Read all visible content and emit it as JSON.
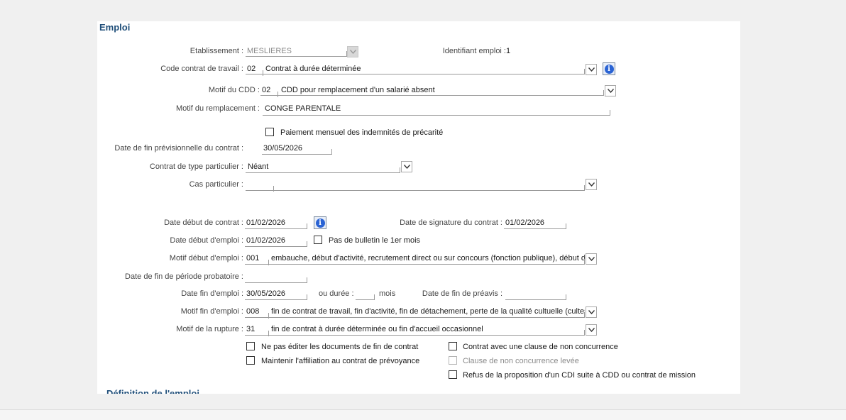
{
  "section_title": "Emploi",
  "next_section_title": "Définition de l'emploi",
  "establishment": {
    "label": "Etablissement :",
    "value": "MESLIERES"
  },
  "job_id": {
    "label": "Identifiant emploi :",
    "value": "1"
  },
  "contract_code": {
    "label": "Code contrat de travail :",
    "code": "02",
    "text": "Contrat à durée déterminée"
  },
  "cdd_reason": {
    "label": "Motif du CDD :",
    "code": "02",
    "text": "CDD pour remplacement d'un salarié absent"
  },
  "replacement_reason": {
    "label": "Motif du remplacement :",
    "value": "CONGE PARENTALE"
  },
  "monthly_payment": {
    "label": "Paiement mensuel des indemnités de précarité",
    "checked": false
  },
  "planned_end_date": {
    "label": "Date de fin prévisionnelle du contrat :",
    "value": "30/05/2026"
  },
  "special_contract": {
    "label": "Contrat de type particulier :",
    "value": "Néant"
  },
  "special_case": {
    "label": "Cas particulier :",
    "value": ""
  },
  "contract_start": {
    "label": "Date début de contrat :",
    "value": "01/02/2026"
  },
  "signature_date": {
    "label": "Date de signature du contrat :",
    "value": "01/02/2026"
  },
  "employment_start": {
    "label": "Date début d'emploi :",
    "value": "01/02/2026"
  },
  "no_payslip": {
    "label": "Pas de bulletin le 1er mois",
    "checked": false
  },
  "start_reason": {
    "label": "Motif début d'emploi :",
    "code": "001",
    "text": "embauche, début d'activité, recrutement direct ou sur concours (fonction publique), début de c"
  },
  "probation_end": {
    "label": "Date de fin de période probatoire :",
    "value": ""
  },
  "employment_end": {
    "label": "Date fin d'emploi :",
    "value": "30/05/2026"
  },
  "duration": {
    "label": "ou durée :",
    "value": "",
    "unit": "mois"
  },
  "notice_end": {
    "label": "Date de fin de préavis :",
    "value": ""
  },
  "end_reason": {
    "label": "Motif fin d'emploi :",
    "code": "008",
    "text": "fin de contrat de travail, fin d'activité, fin de détachement, perte de la qualité cultuelle (cultes)"
  },
  "break_reason": {
    "label": "Motif de la rupture :",
    "code": "31",
    "text": "fin de contrat à durée déterminée ou fin d'accueil occasionnel"
  },
  "checkboxes": {
    "no_end_docs": {
      "label": "Ne pas éditer les documents de fin de contrat",
      "checked": false
    },
    "keep_affiliation": {
      "label": "Maintenir l'affiliation au contrat de prévoyance",
      "checked": false
    },
    "non_compete": {
      "label": "Contrat avec une clause de non concurrence",
      "checked": false
    },
    "non_compete_lifted": {
      "label": "Clause de non concurrence levée",
      "checked": false,
      "disabled": true
    },
    "cdi_refusal": {
      "label": "Refus de la proposition d'un CDI suite à CDD ou contrat de mission",
      "checked": false
    }
  }
}
